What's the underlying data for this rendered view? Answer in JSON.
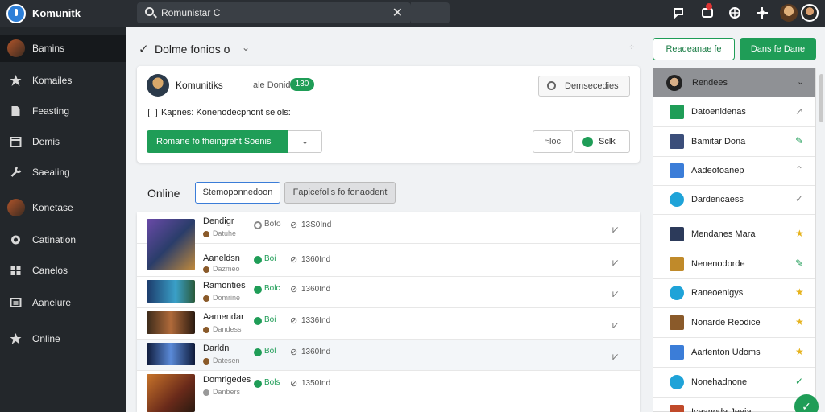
{
  "topbar": {
    "brand": "Komunitk",
    "search_value": "Romunistar C",
    "close_glyph": "✕"
  },
  "sidebar": {
    "items": [
      {
        "label": "Bamins",
        "icon": "avatar"
      },
      {
        "label": "Komailes",
        "icon": "star-icon"
      },
      {
        "label": "Feasting",
        "icon": "note-icon"
      },
      {
        "label": "Demis",
        "icon": "calendar-icon"
      },
      {
        "label": "Saealing",
        "icon": "wrench-icon"
      },
      {
        "label": "Konetase",
        "icon": "avatar"
      },
      {
        "label": "Catination",
        "icon": "gear-icon"
      },
      {
        "label": "Canelos",
        "icon": "grid-icon"
      },
      {
        "label": "Aanelure",
        "icon": "list-icon"
      },
      {
        "label": "Online",
        "icon": "star-icon"
      }
    ]
  },
  "main": {
    "title": "Dolme fonios o",
    "actions": {
      "outline_label": "Readeanae fe",
      "solid_label": "Dans fe Dane"
    },
    "card": {
      "name": "Komunitiks",
      "subtitle": "ale Donidas",
      "pill": "130",
      "search_label": "Demsecedies",
      "description": "Kapnes: Konenodecphont seiols:",
      "primary_label": "Romane fo fheingreht Soenis",
      "dd_label": "⌄",
      "b1_label": "≈loc",
      "b2_label": "Sclk"
    },
    "online": {
      "heading": "Online",
      "tab1": "Stemoponnedoon",
      "tab2": "Fapicefolis fo fonaodent"
    },
    "rows": [
      {
        "name": "Dendigr",
        "sub": "Datuhe",
        "status": "Boto",
        "status_color": "#888888",
        "time": "13S0Ind"
      },
      {
        "name": "Aaneldsn",
        "sub": "Dazmeo",
        "status": "Boi",
        "status_color": "#1f9d57",
        "time": "1360Ind"
      },
      {
        "name": "Ramonties",
        "sub": "Domrine",
        "status": "Bolc",
        "status_color": "#1f9d57",
        "time": "1360Ind"
      },
      {
        "name": "Aamendar",
        "sub": "Dandess",
        "status": "Boi",
        "status_color": "#1f9d57",
        "time": "1336Ind"
      },
      {
        "name": "Darldn",
        "sub": "Datesen",
        "status": "Bol",
        "status_color": "#1f9d57",
        "time": "1360Ind"
      },
      {
        "name": "Domrigedes",
        "sub": "Danbers",
        "status": "Bols",
        "status_color": "#1f9d57",
        "time": "1350Ind"
      }
    ]
  },
  "rpanel": {
    "header": "Rendees",
    "items": [
      {
        "label": "Datoenidenas",
        "icon_color": "#1f9d57",
        "act": "↗",
        "act_color": "#888888"
      },
      {
        "label": "Bamitar Dona",
        "icon_color": "#3b4e7a",
        "act": "✎",
        "act_color": "#1f9d57"
      },
      {
        "label": "Aadeofoanep",
        "icon_color": "#3b7dd8",
        "act": "⌃",
        "act_color": "#888888"
      },
      {
        "label": "Dardencaess",
        "icon_color": "#1fa3d8",
        "act": "✓",
        "act_color": "#888888"
      },
      {
        "label": "Mendanes Mara",
        "icon_color": "#2c3a5a",
        "act": "★",
        "act_color": "#e6b31e"
      },
      {
        "label": "Nenenodorde",
        "icon_color": "#c08a2a",
        "act": "✎",
        "act_color": "#1f9d57"
      },
      {
        "label": "Raneoenigys",
        "icon_color": "#1fa3d8",
        "act": "★",
        "act_color": "#e6b31e"
      },
      {
        "label": "Nonarde Reodice",
        "icon_color": "#8a5a2a",
        "act": "★",
        "act_color": "#e6b31e"
      },
      {
        "label": "Aartenton Udoms",
        "icon_color": "#3b7dd8",
        "act": "★",
        "act_color": "#e6b31e"
      },
      {
        "label": "Nonehadnone",
        "icon_color": "#1fa3d8",
        "act": "✓",
        "act_color": "#1f9d57"
      },
      {
        "label": "Iceanoda Jeeia",
        "icon_color": "#c04a2a",
        "act": "",
        "act_color": "#888888"
      }
    ]
  }
}
